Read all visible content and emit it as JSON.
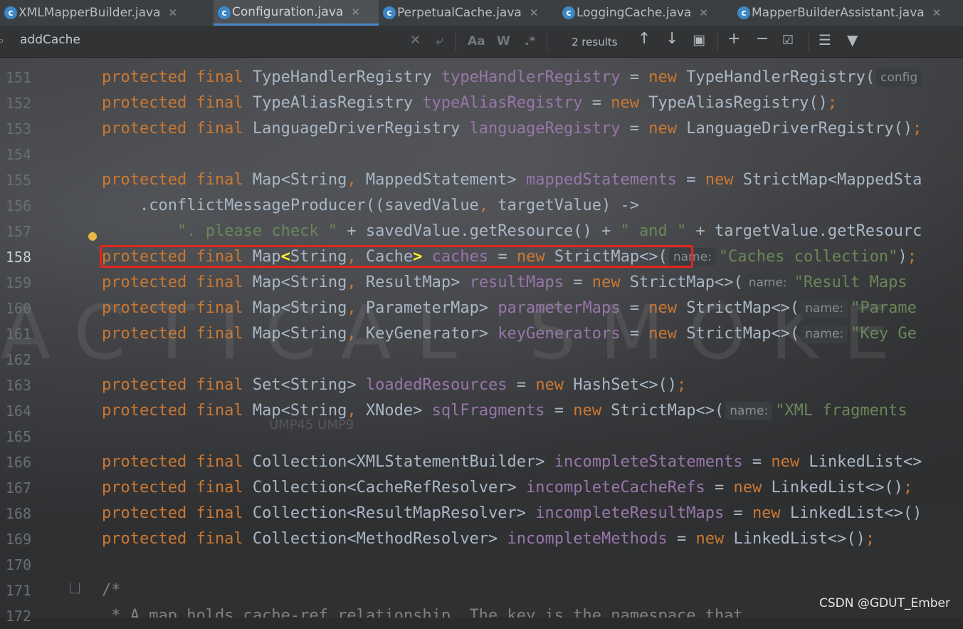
{
  "tabs": [
    {
      "label": "XMLMapperBuilder.java",
      "icon": "c"
    },
    {
      "label": "Configuration.java",
      "icon": "c",
      "active": true
    },
    {
      "label": "PerpetualCache.java",
      "icon": "c"
    },
    {
      "label": "LoggingCache.java",
      "icon": "c"
    },
    {
      "label": "MapperBuilderAssistant.java",
      "icon": "c"
    }
  ],
  "search": {
    "query": "addCache",
    "match_case": "Aa",
    "words": "W",
    "regex": ".*",
    "result_count": "2 results"
  },
  "editor": {
    "current_line": "158",
    "lines": [
      {
        "n": "151",
        "parts": [
          [
            "kw",
            "protected final "
          ],
          [
            "",
            "TypeHandlerRegistry "
          ],
          [
            "fld",
            "typeHandlerRegistry"
          ],
          [
            "",
            " = "
          ],
          [
            "kw",
            "new "
          ],
          [
            "",
            "TypeHandlerRegistry("
          ],
          [
            "hint",
            "config"
          ]
        ]
      },
      {
        "n": "152",
        "parts": [
          [
            "kw",
            "protected final "
          ],
          [
            "",
            "TypeAliasRegistry "
          ],
          [
            "fld",
            "typeAliasRegistry"
          ],
          [
            "",
            " = "
          ],
          [
            "kw",
            "new "
          ],
          [
            "",
            "TypeAliasRegistry()"
          ],
          [
            "kw",
            ";"
          ]
        ]
      },
      {
        "n": "153",
        "parts": [
          [
            "kw",
            "protected final "
          ],
          [
            "",
            "LanguageDriverRegistry "
          ],
          [
            "fld",
            "languageRegistry"
          ],
          [
            "",
            " = "
          ],
          [
            "kw",
            "new "
          ],
          [
            "",
            "LanguageDriverRegistry()"
          ],
          [
            "kw",
            ";"
          ]
        ]
      },
      {
        "n": "154",
        "parts": []
      },
      {
        "n": "155",
        "parts": [
          [
            "kw",
            "protected final "
          ],
          [
            "",
            "Map<String"
          ],
          [
            "kw",
            ", "
          ],
          [
            "",
            "MappedStatement> "
          ],
          [
            "fld",
            "mappedStatements"
          ],
          [
            "",
            " = "
          ],
          [
            "kw",
            "new "
          ],
          [
            "",
            "StrictMap<MappedSta"
          ]
        ]
      },
      {
        "n": "156",
        "parts": [
          [
            "",
            "    .conflictMessageProducer((savedValue"
          ],
          [
            "kw",
            ", "
          ],
          [
            "",
            "targetValue) ->"
          ]
        ]
      },
      {
        "n": "157",
        "parts": [
          [
            "",
            "        "
          ],
          [
            "str",
            "\". please check \""
          ],
          [
            "",
            " + savedValue.getResource() + "
          ],
          [
            "str",
            "\" and \""
          ],
          [
            "",
            " + targetValue.getResourc"
          ]
        ]
      },
      {
        "n": "158",
        "parts": [
          [
            "kw",
            "protected final "
          ],
          [
            "",
            "Map"
          ],
          [
            "brace",
            "<"
          ],
          [
            "",
            "String"
          ],
          [
            "kw",
            ", "
          ],
          [
            "",
            "Cache"
          ],
          [
            "brace",
            ">"
          ],
          [
            "",
            " "
          ],
          [
            "fld",
            "caches"
          ],
          [
            "",
            " = "
          ],
          [
            "kw",
            "new "
          ],
          [
            "",
            "StrictMap<>("
          ],
          [
            "hint",
            "name:"
          ],
          [
            "str",
            "\"Caches collection\""
          ],
          [
            "",
            ")"
          ],
          [
            "kw",
            ";"
          ]
        ]
      },
      {
        "n": "159",
        "parts": [
          [
            "kw",
            "protected final "
          ],
          [
            "",
            "Map<String"
          ],
          [
            "kw",
            ", "
          ],
          [
            "",
            "ResultMap> "
          ],
          [
            "fld",
            "resultMaps"
          ],
          [
            "",
            " = "
          ],
          [
            "kw",
            "new "
          ],
          [
            "",
            "StrictMap<>("
          ],
          [
            "hint",
            "name:"
          ],
          [
            "str",
            "\"Result Maps"
          ]
        ]
      },
      {
        "n": "160",
        "parts": [
          [
            "kw",
            "protected final "
          ],
          [
            "",
            "Map<String"
          ],
          [
            "kw",
            ", "
          ],
          [
            "",
            "ParameterMap> "
          ],
          [
            "fld",
            "parameterMaps"
          ],
          [
            "",
            " = "
          ],
          [
            "kw",
            "new "
          ],
          [
            "",
            "StrictMap<>("
          ],
          [
            "hint",
            "name:"
          ],
          [
            "str",
            "\"Parame"
          ]
        ]
      },
      {
        "n": "161",
        "parts": [
          [
            "kw",
            "protected final "
          ],
          [
            "",
            "Map<String"
          ],
          [
            "kw",
            ", "
          ],
          [
            "",
            "KeyGenerator> "
          ],
          [
            "fld",
            "keyGenerators"
          ],
          [
            "",
            " = "
          ],
          [
            "kw",
            "new "
          ],
          [
            "",
            "StrictMap<>("
          ],
          [
            "hint",
            "name:"
          ],
          [
            "str",
            "\"Key Ge"
          ]
        ]
      },
      {
        "n": "162",
        "parts": []
      },
      {
        "n": "163",
        "parts": [
          [
            "kw",
            "protected final "
          ],
          [
            "",
            "Set<String> "
          ],
          [
            "fld",
            "loadedResources"
          ],
          [
            "",
            " = "
          ],
          [
            "kw",
            "new "
          ],
          [
            "",
            "HashSet<>()"
          ],
          [
            "kw",
            ";"
          ]
        ]
      },
      {
        "n": "164",
        "parts": [
          [
            "kw",
            "protected final "
          ],
          [
            "",
            "Map<String"
          ],
          [
            "kw",
            ", "
          ],
          [
            "",
            "XNode> "
          ],
          [
            "fld",
            "sqlFragments"
          ],
          [
            "",
            " = "
          ],
          [
            "kw",
            "new "
          ],
          [
            "",
            "StrictMap<>("
          ],
          [
            "hint",
            "name:"
          ],
          [
            "str",
            "\"XML fragments"
          ]
        ]
      },
      {
        "n": "165",
        "parts": []
      },
      {
        "n": "166",
        "parts": [
          [
            "kw",
            "protected final "
          ],
          [
            "",
            "Collection<XMLStatementBuilder> "
          ],
          [
            "fld",
            "incompleteStatements"
          ],
          [
            "",
            " = "
          ],
          [
            "kw",
            "new "
          ],
          [
            "",
            "LinkedList<>"
          ]
        ]
      },
      {
        "n": "167",
        "parts": [
          [
            "kw",
            "protected final "
          ],
          [
            "",
            "Collection<CacheRefResolver> "
          ],
          [
            "fld",
            "incompleteCacheRefs"
          ],
          [
            "",
            " = "
          ],
          [
            "kw",
            "new "
          ],
          [
            "",
            "LinkedList<>()"
          ],
          [
            "kw",
            ";"
          ]
        ]
      },
      {
        "n": "168",
        "parts": [
          [
            "kw",
            "protected final "
          ],
          [
            "",
            "Collection<ResultMapResolver> "
          ],
          [
            "fld",
            "incompleteResultMaps"
          ],
          [
            "",
            " = "
          ],
          [
            "kw",
            "new "
          ],
          [
            "",
            "LinkedList<>()"
          ]
        ]
      },
      {
        "n": "169",
        "parts": [
          [
            "kw",
            "protected final "
          ],
          [
            "",
            "Collection<MethodResolver> "
          ],
          [
            "fld",
            "incompleteMethods"
          ],
          [
            "",
            " = "
          ],
          [
            "kw",
            "new "
          ],
          [
            "",
            "LinkedList<>()"
          ],
          [
            "kw",
            ";"
          ]
        ]
      },
      {
        "n": "170",
        "parts": []
      },
      {
        "n": "171",
        "parts": [
          [
            "cmt",
            "/*"
          ]
        ]
      },
      {
        "n": "172",
        "parts": [
          [
            "cmt",
            " * A map holds cache-ref relationship. The key is the namespace that"
          ]
        ]
      }
    ]
  },
  "watermark": {
    "big": "ACTICAL SMOKE",
    "small": "UMP45 UMP9"
  },
  "credit": "CSDN @GDUT_Ember",
  "colors": {
    "keyword": "#cc7832",
    "field": "#9876aa",
    "string": "#6a8759",
    "highlight_box": "#e5251e"
  }
}
